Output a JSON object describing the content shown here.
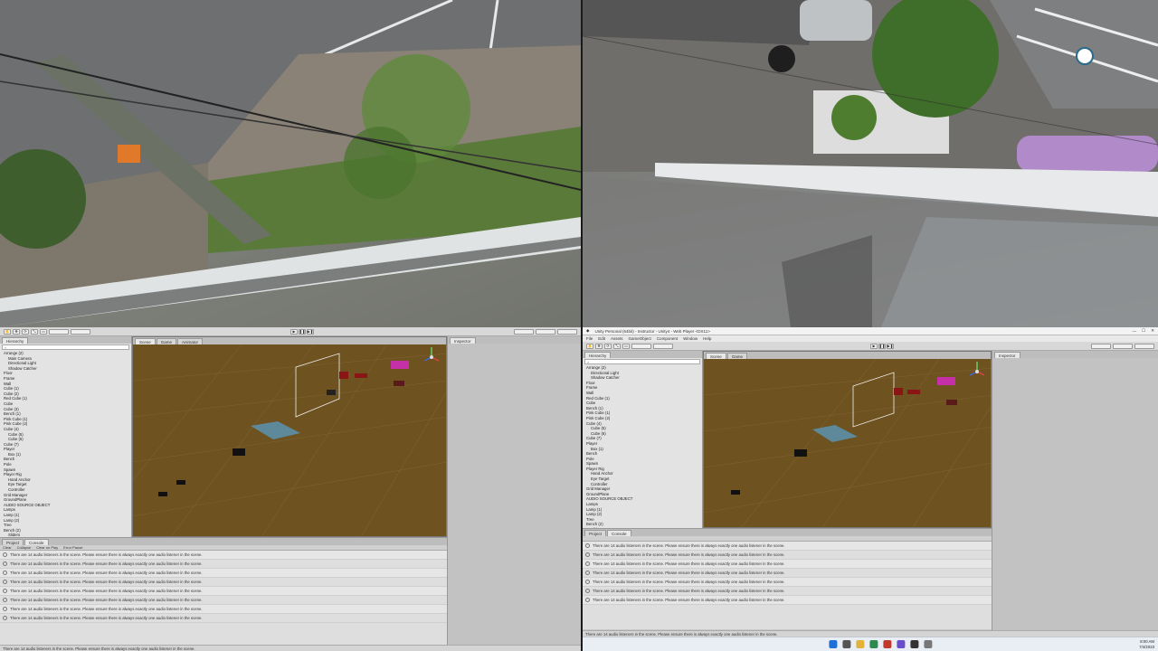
{
  "left_editor": {
    "hierarchy_tab": "Hierarchy",
    "hierarchy_items": [
      {
        "label": "Arrange (2)",
        "level": 0
      },
      {
        "label": "Main Camera",
        "level": 1
      },
      {
        "label": "Directional Light",
        "level": 1
      },
      {
        "label": "Shadow Catcher",
        "level": 1
      },
      {
        "label": "Floor",
        "level": 0
      },
      {
        "label": "Frame",
        "level": 0
      },
      {
        "label": "Wall",
        "level": 0
      },
      {
        "label": "Cube (1)",
        "level": 0
      },
      {
        "label": "Cube (2)",
        "level": 0
      },
      {
        "label": "Red Cube (1)",
        "level": 0
      },
      {
        "label": "Cube",
        "level": 0
      },
      {
        "label": "Cube (3)",
        "level": 0
      },
      {
        "label": "Bench (1)",
        "level": 0
      },
      {
        "label": "Pink Cube (1)",
        "level": 0
      },
      {
        "label": "Pink Cube (2)",
        "level": 0
      },
      {
        "label": "Cube (4)",
        "level": 0
      },
      {
        "label": "Cube (5)",
        "level": 1
      },
      {
        "label": "Cube (6)",
        "level": 1
      },
      {
        "label": "Cube (7)",
        "level": 0
      },
      {
        "label": "Player",
        "level": 0
      },
      {
        "label": "Box (1)",
        "level": 1
      },
      {
        "label": "Bench",
        "level": 0
      },
      {
        "label": "Pole",
        "level": 0
      },
      {
        "label": "Spawn",
        "level": 0
      },
      {
        "label": "Player Rig",
        "level": 0
      },
      {
        "label": "Hand Anchor",
        "level": 1
      },
      {
        "label": "Eye Target",
        "level": 1
      },
      {
        "label": "Controller",
        "level": 1
      },
      {
        "label": "Grid Manager",
        "level": 0
      },
      {
        "label": "GroundPlane",
        "level": 0
      },
      {
        "label": "AUDIO SOURCE OBJECT",
        "level": 0
      },
      {
        "label": "Lamps",
        "level": 0
      },
      {
        "label": "Lamp (1)",
        "level": 0
      },
      {
        "label": "Lamp (2)",
        "level": 0
      },
      {
        "label": "Tree",
        "level": 0
      },
      {
        "label": "Bench (2)",
        "level": 0
      },
      {
        "label": "Sliders",
        "level": 1
      }
    ],
    "scene_tabs": [
      "Scene",
      "Game",
      "Animator"
    ],
    "inspector_tab": "Inspector",
    "console_tabs": [
      "Project",
      "Console"
    ],
    "console_toolbar": [
      "Clear",
      "Collapse",
      "Clear on Play",
      "Error Pause"
    ],
    "console_messages": [
      "There are 14 audio listeners in the scene. Please ensure there is always exactly one audio listener in the scene.",
      "There are 14 audio listeners in the scene. Please ensure there is always exactly one audio listener in the scene.",
      "There are 14 audio listeners in the scene. Please ensure there is always exactly one audio listener in the scene.",
      "There are 14 audio listeners in the scene. Please ensure there is always exactly one audio listener in the scene.",
      "There are 14 audio listeners in the scene. Please ensure there is always exactly one audio listener in the scene.",
      "There are 14 audio listeners in the scene. Please ensure there is always exactly one audio listener in the scene.",
      "There are 14 audio listeners in the scene. Please ensure there is always exactly one audio listener in the scene.",
      "There are 14 audio listeners in the scene. Please ensure there is always exactly one audio listener in the scene."
    ],
    "status": "There are 14 audio listeners in the scene. Please ensure there is always exactly one audio listener in the scene."
  },
  "right_editor": {
    "title": "Unity Personal (64bit) - Instructor - Unity4 - Web Player <DX11>",
    "menu": [
      "File",
      "Edit",
      "Assets",
      "GameObject",
      "Component",
      "Window",
      "Help"
    ],
    "hierarchy_tab": "Hierarchy",
    "inspector_tab": "Inspector",
    "hierarchy_items": [
      {
        "label": "Arrange (2)",
        "level": 0
      },
      {
        "label": "Directional Light",
        "level": 1
      },
      {
        "label": "Shadow Catcher",
        "level": 1
      },
      {
        "label": "Floor",
        "level": 0
      },
      {
        "label": "Frame",
        "level": 0
      },
      {
        "label": "Wall",
        "level": 0
      },
      {
        "label": "Red Cube (1)",
        "level": 0
      },
      {
        "label": "Cube",
        "level": 0
      },
      {
        "label": "Bench (1)",
        "level": 0
      },
      {
        "label": "Pink Cube (1)",
        "level": 0
      },
      {
        "label": "Pink Cube (2)",
        "level": 0
      },
      {
        "label": "Cube (4)",
        "level": 0
      },
      {
        "label": "Cube (5)",
        "level": 1
      },
      {
        "label": "Cube (6)",
        "level": 1
      },
      {
        "label": "Cube (7)",
        "level": 0
      },
      {
        "label": "Player",
        "level": 0
      },
      {
        "label": "Box (1)",
        "level": 1
      },
      {
        "label": "Bench",
        "level": 0
      },
      {
        "label": "Pole",
        "level": 0
      },
      {
        "label": "Spawn",
        "level": 0
      },
      {
        "label": "Player Rig",
        "level": 0
      },
      {
        "label": "Hand Anchor",
        "level": 1
      },
      {
        "label": "Eye Target",
        "level": 1
      },
      {
        "label": "Controller",
        "level": 1
      },
      {
        "label": "Grid Manager",
        "level": 0
      },
      {
        "label": "GroundPlane",
        "level": 0
      },
      {
        "label": "AUDIO SOURCE OBJECT",
        "level": 0
      },
      {
        "label": "Lamps",
        "level": 0
      },
      {
        "label": "Lamp (1)",
        "level": 0
      },
      {
        "label": "Lamp (2)",
        "level": 0
      },
      {
        "label": "Tree",
        "level": 0
      },
      {
        "label": "Bench (2)",
        "level": 0
      },
      {
        "label": "Sliders",
        "level": 1
      }
    ],
    "scene_tabs": [
      "Scene",
      "Game"
    ],
    "console_tabs": [
      "Project",
      "Console"
    ],
    "console_messages": [
      "There are 14 audio listeners in the scene. Please ensure there is always exactly one audio listener in the scene.",
      "There are 14 audio listeners in the scene. Please ensure there is always exactly one audio listener in the scene.",
      "There are 14 audio listeners in the scene. Please ensure there is always exactly one audio listener in the scene.",
      "There are 14 audio listeners in the scene. Please ensure there is always exactly one audio listener in the scene.",
      "There are 14 audio listeners in the scene. Please ensure there is always exactly one audio listener in the scene.",
      "There are 14 audio listeners in the scene. Please ensure there is always exactly one audio listener in the scene.",
      "There are 14 audio listeners in the scene. Please ensure there is always exactly one audio listener in the scene."
    ],
    "status": "There are 14 audio listeners in the scene. Please ensure there is always exactly one audio listener in the scene."
  },
  "taskbar": {
    "time": "8:00 AM",
    "date": "7/4/2023",
    "icons": [
      "windows-start-icon",
      "search-icon",
      "file-explorer-icon",
      "browser-icon",
      "shield-icon",
      "store-icon",
      "unity-icon",
      "settings-icon"
    ]
  },
  "colors": {
    "scene_floor": "#6e5220",
    "editor_bg": "#c8c8c8",
    "hierarchy_bg": "#e3e3e3",
    "console_bg": "#dedede"
  }
}
